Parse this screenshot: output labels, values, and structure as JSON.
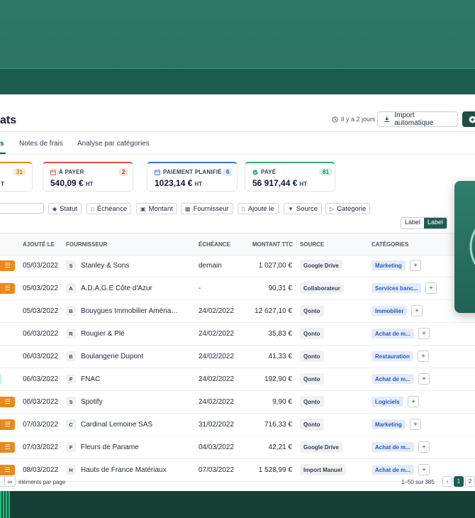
{
  "header": {
    "title_fragment": "ats",
    "sync_text": "Il y a 2 jours",
    "import_label": "Import automatique"
  },
  "tabs": [
    {
      "label": "s",
      "active": true
    },
    {
      "label": "Notes de frais",
      "active": false
    },
    {
      "label": "Analyse par catégories",
      "active": false
    }
  ],
  "summary_cards": [
    {
      "label": "",
      "count": "31",
      "amount_suffix": "T",
      "color": "#e8891f"
    },
    {
      "label": "À PAYER",
      "count": "2",
      "amount": "540,09 €",
      "unit": "HT",
      "color": "#e04c4c"
    },
    {
      "label": "PAIEMENT PLANIFIÉ",
      "count": "6",
      "amount": "1023,14 €",
      "unit": "HT",
      "color": "#3e6fe0"
    },
    {
      "label": "PAYÉ",
      "count": "81",
      "amount": "56 917,44 €",
      "unit": "HT",
      "color": "#34a872"
    }
  ],
  "filters": [
    "Statut",
    "Échéance",
    "Montant",
    "Fournisseur",
    "Ajouté le",
    "Source",
    "Catégorie"
  ],
  "view_toggle": {
    "off": "Label",
    "on": "Label"
  },
  "columns": {
    "added": "AJOUTÉ LE",
    "supplier": "FOURNISSEUR",
    "due": "ÉCHÉANCE",
    "amount": "MONTANT TTC",
    "source": "SOURCE",
    "categories": "CATÉGORIES"
  },
  "rows": [
    {
      "tag": "orange",
      "date": "05/03/2022",
      "initial": "S",
      "supplier": "Stanley & Sons",
      "due": "demain",
      "amount": "1 027,00 €",
      "source": "Google Drive",
      "category": "Marketing"
    },
    {
      "tag": "orange",
      "date": "05/03/2022",
      "initial": "A",
      "supplier": "A.D.A.G.E Côte d'Azur",
      "due": "-",
      "amount": "90,31 €",
      "source": "Collaborateur",
      "category": "Services banc..."
    },
    {
      "tag": "none",
      "date": "05/03/2022",
      "initial": "B",
      "supplier": "Bouygues Immobilier Aménag...",
      "due": "24/02/2022",
      "amount": "12 627,10 €",
      "source": "Qonto",
      "category": "Immobilier"
    },
    {
      "tag": "none",
      "date": "06/03/2022",
      "initial": "R",
      "supplier": "Rougier & Plé",
      "due": "24/02/2022",
      "amount": "35,83 €",
      "source": "Qonto",
      "category": "Achat de m..."
    },
    {
      "tag": "none",
      "date": "06/03/2022",
      "initial": "B",
      "supplier": "Boulangerie Dupont",
      "due": "24/02/2022",
      "amount": "41,33 €",
      "source": "Qonto",
      "category": "Restauration"
    },
    {
      "tag": "green",
      "date": "06/03/2022",
      "initial": "F",
      "supplier": "FNAC",
      "due": "24/02/2022",
      "amount": "192,90 €",
      "source": "Qonto",
      "category": "Achat de m..."
    },
    {
      "tag": "orange",
      "date": "06/03/2022",
      "initial": "S",
      "supplier": "Spotify",
      "due": "24/02/2022",
      "amount": "9,90 €",
      "source": "Qonto",
      "category": "Logiciels"
    },
    {
      "tag": "orange",
      "date": "07/03/2022",
      "initial": "C",
      "supplier": "Cardinal Lemoine SAS",
      "due": "31/02/2022",
      "amount": "716,33 €",
      "source": "Qonto",
      "category": "Marketing"
    },
    {
      "tag": "orange",
      "date": "07/03/2022",
      "initial": "F",
      "supplier": "Fleurs de Paname",
      "due": "04/03/2022",
      "amount": "42,21 €",
      "source": "Google Drive",
      "category": "Achat de m..."
    },
    {
      "tag": "orange",
      "date": "08/03/2022",
      "initial": "H",
      "supplier": "Hauts de France Matériaux",
      "due": "07/03/2022",
      "amount": "1 528,99 €",
      "source": "Import Manuel",
      "category": "Achat de m..."
    }
  ],
  "footer": {
    "per_page_symbol": "∞",
    "per_page_label": "éléments par page",
    "range": "1–50 sur 385",
    "pages": [
      "1",
      "2"
    ]
  }
}
